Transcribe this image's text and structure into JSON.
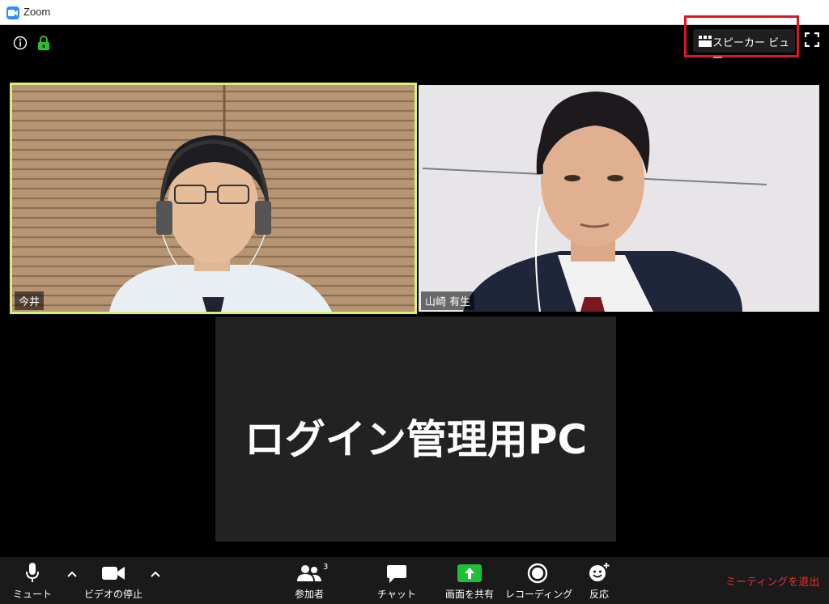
{
  "window": {
    "title": "Zoom"
  },
  "top_bar": {
    "view_switch_label": "スピーカー ビュー"
  },
  "participants": [
    {
      "name": "今井"
    },
    {
      "name": "山崎 有生"
    },
    {
      "name": "ログイン管理用PC"
    }
  ],
  "toolbar": {
    "mute_label": "ミュート",
    "video_label": "ビデオの停止",
    "participants_label": "参加者",
    "participants_count": "3",
    "chat_label": "チャット",
    "share_label": "画面を共有",
    "record_label": "レコーディング",
    "reactions_label": "反応",
    "leave_label": "ミーティングを退出"
  },
  "colors": {
    "active_speaker_border": "#d6f07a",
    "highlight": "#e0141e",
    "share_green": "#1fbf3a",
    "leave_red": "#e5312f",
    "lock_green": "#2cc12c"
  }
}
